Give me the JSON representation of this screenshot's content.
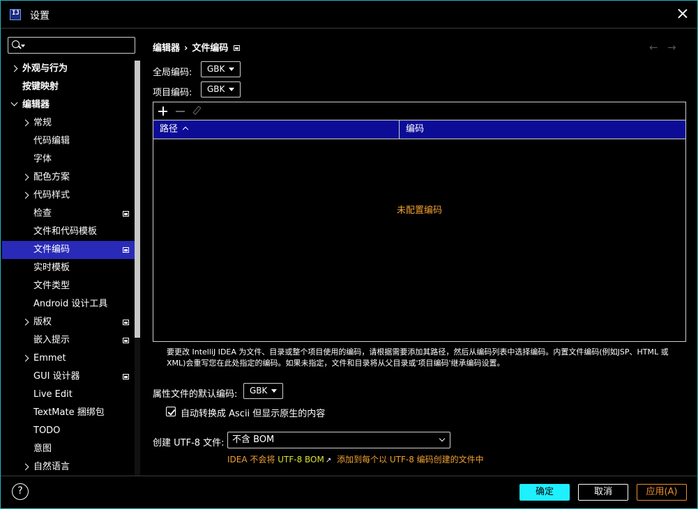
{
  "window": {
    "title": "设置",
    "logo_text": "IJ"
  },
  "search": {
    "placeholder": ""
  },
  "tree": [
    {
      "label": "外观与行为",
      "level": 0,
      "expander": "right",
      "bold": true,
      "badge": false,
      "selected": false
    },
    {
      "label": "按键映射",
      "level": 0,
      "expander": "none",
      "bold": true,
      "badge": false,
      "selected": false
    },
    {
      "label": "编辑器",
      "level": 0,
      "expander": "down",
      "bold": true,
      "badge": false,
      "selected": false
    },
    {
      "label": "常规",
      "level": 1,
      "expander": "right",
      "bold": false,
      "badge": false,
      "selected": false
    },
    {
      "label": "代码编辑",
      "level": 1,
      "expander": "none",
      "bold": false,
      "badge": false,
      "selected": false
    },
    {
      "label": "字体",
      "level": 1,
      "expander": "none",
      "bold": false,
      "badge": false,
      "selected": false
    },
    {
      "label": "配色方案",
      "level": 1,
      "expander": "right",
      "bold": false,
      "badge": false,
      "selected": false
    },
    {
      "label": "代码样式",
      "level": 1,
      "expander": "right",
      "bold": false,
      "badge": false,
      "selected": false
    },
    {
      "label": "检查",
      "level": 1,
      "expander": "none",
      "bold": false,
      "badge": true,
      "selected": false
    },
    {
      "label": "文件和代码模板",
      "level": 1,
      "expander": "none",
      "bold": false,
      "badge": false,
      "selected": false
    },
    {
      "label": "文件编码",
      "level": 1,
      "expander": "none",
      "bold": false,
      "badge": true,
      "selected": true
    },
    {
      "label": "实时模板",
      "level": 1,
      "expander": "none",
      "bold": false,
      "badge": false,
      "selected": false
    },
    {
      "label": "文件类型",
      "level": 1,
      "expander": "none",
      "bold": false,
      "badge": false,
      "selected": false
    },
    {
      "label": "Android 设计工具",
      "level": 1,
      "expander": "none",
      "bold": false,
      "badge": false,
      "selected": false
    },
    {
      "label": "版权",
      "level": 1,
      "expander": "right",
      "bold": false,
      "badge": true,
      "selected": false
    },
    {
      "label": "嵌入提示",
      "level": 1,
      "expander": "none",
      "bold": false,
      "badge": true,
      "selected": false
    },
    {
      "label": "Emmet",
      "level": 1,
      "expander": "right",
      "bold": false,
      "badge": false,
      "selected": false
    },
    {
      "label": "GUI 设计器",
      "level": 1,
      "expander": "none",
      "bold": false,
      "badge": true,
      "selected": false
    },
    {
      "label": "Live Edit",
      "level": 1,
      "expander": "none",
      "bold": false,
      "badge": false,
      "selected": false
    },
    {
      "label": "TextMate 捆绑包",
      "level": 1,
      "expander": "none",
      "bold": false,
      "badge": false,
      "selected": false
    },
    {
      "label": "TODO",
      "level": 1,
      "expander": "none",
      "bold": false,
      "badge": false,
      "selected": false
    },
    {
      "label": "意图",
      "level": 1,
      "expander": "none",
      "bold": false,
      "badge": false,
      "selected": false
    },
    {
      "label": "自然语言",
      "level": 1,
      "expander": "right",
      "bold": false,
      "badge": false,
      "selected": false
    }
  ],
  "breadcrumb": {
    "parent": "编辑器",
    "separator": "›",
    "current": "文件编码"
  },
  "nav": {
    "back": "←",
    "forward": "→"
  },
  "global_encoding": {
    "label": "全局编码:",
    "value": "GBK"
  },
  "project_encoding": {
    "label": "项目编码:",
    "value": "GBK"
  },
  "table": {
    "columns": [
      "路径",
      "编码"
    ],
    "empty_text": "未配置编码"
  },
  "help_text": "要更改 IntelliJ IDEA 为文件、目录或整个项目使用的编码，请根据需要添加其路径，然后从编码列表中选择编码。内置文件编码(例如JSP、HTML 或 XML)会重写您在此处指定的编码。如果未指定，文件和目录将从父目录或'项目编码'继承编码设置。",
  "properties": {
    "label": "属性文件的默认编码:",
    "value": "GBK"
  },
  "ascii_checkbox": {
    "label": "自动转换成 Ascii 但显示原生的内容",
    "checked": true
  },
  "bom": {
    "label": "创建 UTF-8 文件:",
    "value": "不含 BOM"
  },
  "bom_note": {
    "prefix": "IDEA 不会将",
    "link": "UTF-8 BOM",
    "arrow": "↗",
    "suffix": "添加到每个以 UTF-8 编码创建的文件中"
  },
  "buttons": {
    "help": "?",
    "ok": "确定",
    "cancel": "取消",
    "apply": "应用(A)"
  },
  "colors": {
    "accent": "#1ff0ff",
    "selection": "#2a2ab8",
    "header": "#0c0c96",
    "warning": "#f0a030",
    "link": "#d8e030"
  }
}
